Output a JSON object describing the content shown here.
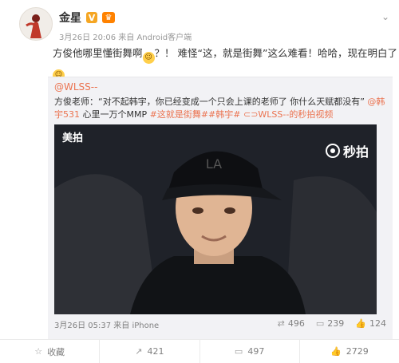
{
  "post": {
    "author": "金星",
    "meta": "3月26日 20:06 来自 Android客户端",
    "text_before": "方俊他哪里懂街舞啊",
    "text_after": "？！ 难怪“这，就是街舞”这么难看！哈哈，现在明白了！"
  },
  "repost": {
    "user": "@WLSS--",
    "text_prefix": "方俊老师：“对不起韩宇，你已经变成一个只会上课的老师了 你什么天赋都没有”",
    "mention": "@韩宇531",
    "text_mid": " 心里一万个MMP ",
    "tags": "#这就是街舞##韩宇#",
    "video_link": "⊂⊃WLSS--的秒拍视频",
    "watermark_left": "美拍",
    "watermark_right": "秒拍",
    "meta": "3月26日 05:37 来自 iPhone",
    "reposts": "496",
    "comments": "239",
    "likes": "124"
  },
  "actions": {
    "favorite": "收藏",
    "repost": "421",
    "comment": "497",
    "like": "2729"
  },
  "colors": {
    "link": "#eb7350",
    "vip": "#ff8200"
  }
}
